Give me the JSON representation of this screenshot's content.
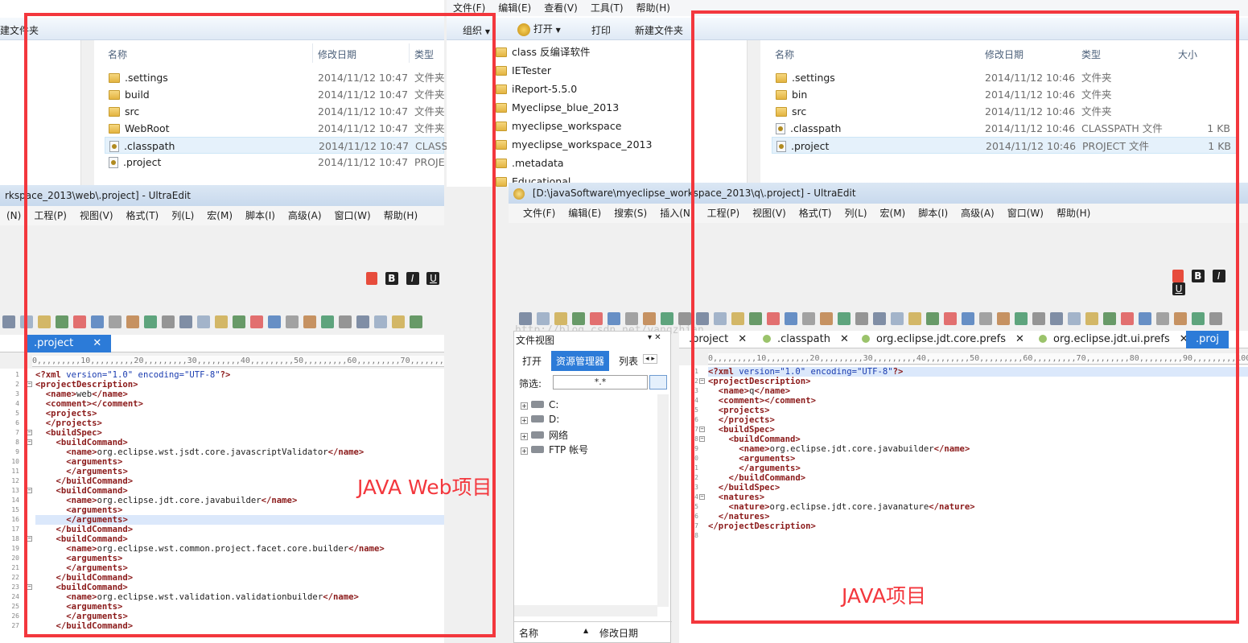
{
  "left_explorer": {
    "toolbar_new_folder": "建文件夹",
    "columns": {
      "name": "名称",
      "date": "修改日期",
      "type": "类型"
    },
    "rows": [
      {
        "name": ".settings",
        "date": "2014/11/12 10:47",
        "type": "文件夹",
        "icon": "folder"
      },
      {
        "name": "build",
        "date": "2014/11/12 10:47",
        "type": "文件夹",
        "icon": "folder"
      },
      {
        "name": "src",
        "date": "2014/11/12 10:47",
        "type": "文件夹",
        "icon": "folder"
      },
      {
        "name": "WebRoot",
        "date": "2014/11/12 10:47",
        "type": "文件夹",
        "icon": "folder"
      },
      {
        "name": ".classpath",
        "date": "2014/11/12 10:47",
        "type": "CLASS",
        "icon": "file"
      },
      {
        "name": ".project",
        "date": "2014/11/12 10:47",
        "type": "PROJE",
        "icon": "file"
      }
    ]
  },
  "right_explorer": {
    "menu": [
      "文件(F)",
      "编辑(E)",
      "查看(V)",
      "工具(T)",
      "帮助(H)"
    ],
    "toolbar": {
      "organize": "组织",
      "open": "打开",
      "print": "打印",
      "new_folder": "新建文件夹"
    },
    "tree": [
      "class 反编译软件",
      "IETester",
      "iReport-5.5.0",
      "Myeclipse_blue_2013",
      "myeclipse_workspace",
      "myeclipse_workspace_2013",
      ".metadata",
      "Educational"
    ],
    "columns": {
      "name": "名称",
      "date": "修改日期",
      "type": "类型",
      "size": "大小"
    },
    "rows": [
      {
        "name": ".settings",
        "date": "2014/11/12 10:46",
        "type": "文件夹",
        "size": "",
        "icon": "folder"
      },
      {
        "name": "bin",
        "date": "2014/11/12 10:46",
        "type": "文件夹",
        "size": "",
        "icon": "folder"
      },
      {
        "name": "src",
        "date": "2014/11/12 10:46",
        "type": "文件夹",
        "size": "",
        "icon": "folder"
      },
      {
        "name": ".classpath",
        "date": "2014/11/12 10:46",
        "type": "CLASSPATH 文件",
        "size": "1 KB",
        "icon": "file"
      },
      {
        "name": ".project",
        "date": "2014/11/12 10:46",
        "type": "PROJECT 文件",
        "size": "1 KB",
        "icon": "file"
      }
    ]
  },
  "left_ue": {
    "title": "rkspace_2013\\web\\.project] - UltraEdit",
    "menu": [
      "(N)",
      "工程(P)",
      "视图(V)",
      "格式(T)",
      "列(L)",
      "宏(M)",
      "脚本(I)",
      "高级(A)",
      "窗口(W)",
      "帮助(H)"
    ],
    "tab": ".project",
    "ruler": "0,,,,,,,,,10,,,,,,,,,20,,,,,,,,,30,,,,,,,,,40,,,,,,,,,50,,,,,,,,,60,,,,,,,,,70,,,,,,,,,80,,,,,,,,,90",
    "lines": [
      "<?xml version=\"1.0\" encoding=\"UTF-8\"?>",
      "<projectDescription>",
      "  <name>web</name>",
      "  <comment></comment>",
      "  <projects>",
      "  </projects>",
      "  <buildSpec>",
      "    <buildCommand>",
      "      <name>org.eclipse.wst.jsdt.core.javascriptValidator</name>",
      "      <arguments>",
      "      </arguments>",
      "    </buildCommand>",
      "    <buildCommand>",
      "      <name>org.eclipse.jdt.core.javabuilder</name>",
      "      <arguments>",
      "      </arguments>",
      "    </buildCommand>",
      "    <buildCommand>",
      "      <name>org.eclipse.wst.common.project.facet.core.builder</name>",
      "      <arguments>",
      "      </arguments>",
      "    </buildCommand>",
      "    <buildCommand>",
      "      <name>org.eclipse.wst.validation.validationbuilder</name>",
      "      <arguments>",
      "      </arguments>",
      "    </buildCommand>"
    ]
  },
  "right_ue": {
    "title": "[D:\\javaSoftware\\myeclipse_workspace_2013\\q\\.project] - UltraEdit",
    "menu": [
      "文件(F)",
      "编辑(E)",
      "搜索(S)",
      "插入(N)",
      "工程(P)",
      "视图(V)",
      "格式(T)",
      "列(L)",
      "宏(M)",
      "脚本(I)",
      "高级(A)",
      "窗口(W)",
      "帮助(H)"
    ],
    "watermark": "http://blog.csdn.net/yangzhian",
    "file_view": {
      "title": "文件视图",
      "tabs": [
        "打开",
        "资源管理器",
        "列表"
      ],
      "filter_label": "筛选:",
      "filter_value": "*.*",
      "tree": [
        "C:",
        "D:",
        "网络",
        "FTP 帐号"
      ],
      "bottom_columns": {
        "name": "名称",
        "date": "修改日期"
      }
    },
    "tabs": [
      ".project",
      ".classpath",
      "org.eclipse.jdt.core.prefs",
      "org.eclipse.jdt.ui.prefs",
      ".proj"
    ],
    "ruler": "0,,,,,,,,,10,,,,,,,,,20,,,,,,,,,30,,,,,,,,,40,,,,,,,,,50,,,,,,,,,60,,,,,,,,,70,,,,,,,,,80,,,,,,,,,90,,,,,,,,,100",
    "lines": [
      "<?xml version=\"1.0\" encoding=\"UTF-8\"?>",
      "<projectDescription>",
      "  <name>q</name>",
      "  <comment></comment>",
      "  <projects>",
      "  </projects>",
      "  <buildSpec>",
      "    <buildCommand>",
      "      <name>org.eclipse.jdt.core.javabuilder</name>",
      "      <arguments>",
      "      </arguments>",
      "    </buildCommand>",
      "  </buildSpec>",
      "  <natures>",
      "    <nature>org.eclipse.jdt.core.javanature</nature>",
      "  </natures>",
      "</projectDescription>",
      ""
    ]
  },
  "annotations": {
    "web": "JAVA Web项目",
    "java": "JAVA项目"
  },
  "colors": {
    "annotation_red": "#f3373d",
    "tab_active_blue": "#2c7bd8",
    "xml_tag": "#8b1a1a",
    "xml_attr": "#1a3cb0"
  }
}
